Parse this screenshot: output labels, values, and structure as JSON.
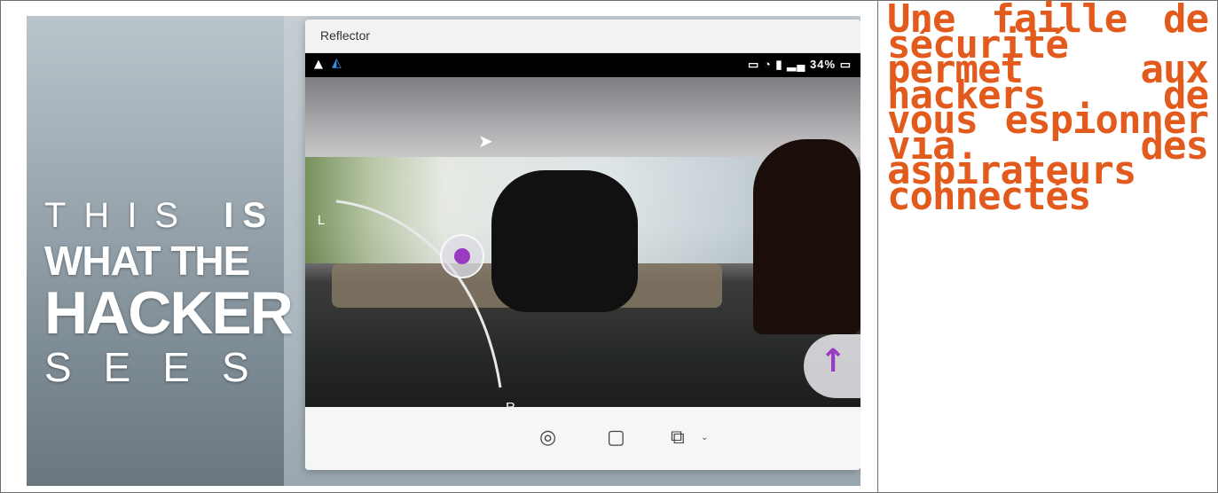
{
  "promo": {
    "line1": "THIS",
    "line1b": "IS",
    "line2": "WHAT THE",
    "line3": "HACKER",
    "line4": "SEES"
  },
  "reflector": {
    "title": "Reflector",
    "status_right": "34%",
    "status_icons": [
      "laptop-icon",
      "wifi-icon",
      "battery-icon",
      "signal-icon"
    ],
    "joystick_left_label": "L",
    "joystick_right_label": "R",
    "toolbar": [
      "camera-icon",
      "fullscreen-icon",
      "cast-icon"
    ]
  },
  "headline": "Une faille de sécurité permet aux hackers de vous espionner via des aspirateurs connectés",
  "colors": {
    "headline": "#e25a1c",
    "joystick_accent": "#9b3bc2"
  }
}
